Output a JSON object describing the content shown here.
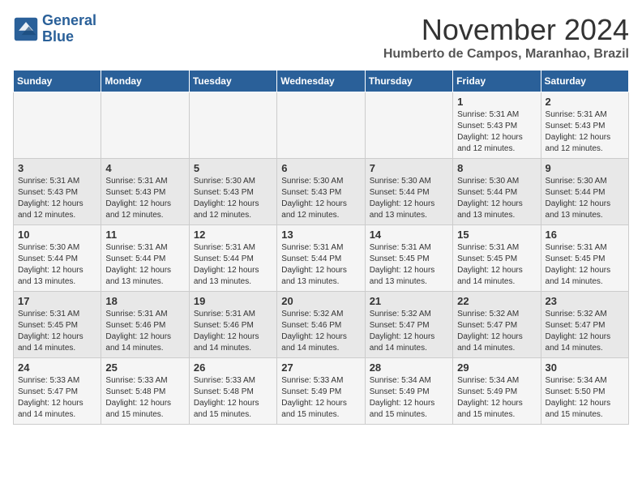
{
  "header": {
    "logo_line1": "General",
    "logo_line2": "Blue",
    "month_year": "November 2024",
    "location": "Humberto de Campos, Maranhao, Brazil"
  },
  "days_of_week": [
    "Sunday",
    "Monday",
    "Tuesday",
    "Wednesday",
    "Thursday",
    "Friday",
    "Saturday"
  ],
  "weeks": [
    [
      {
        "day": "",
        "info": ""
      },
      {
        "day": "",
        "info": ""
      },
      {
        "day": "",
        "info": ""
      },
      {
        "day": "",
        "info": ""
      },
      {
        "day": "",
        "info": ""
      },
      {
        "day": "1",
        "info": "Sunrise: 5:31 AM\nSunset: 5:43 PM\nDaylight: 12 hours\nand 12 minutes."
      },
      {
        "day": "2",
        "info": "Sunrise: 5:31 AM\nSunset: 5:43 PM\nDaylight: 12 hours\nand 12 minutes."
      }
    ],
    [
      {
        "day": "3",
        "info": "Sunrise: 5:31 AM\nSunset: 5:43 PM\nDaylight: 12 hours\nand 12 minutes."
      },
      {
        "day": "4",
        "info": "Sunrise: 5:31 AM\nSunset: 5:43 PM\nDaylight: 12 hours\nand 12 minutes."
      },
      {
        "day": "5",
        "info": "Sunrise: 5:30 AM\nSunset: 5:43 PM\nDaylight: 12 hours\nand 12 minutes."
      },
      {
        "day": "6",
        "info": "Sunrise: 5:30 AM\nSunset: 5:43 PM\nDaylight: 12 hours\nand 12 minutes."
      },
      {
        "day": "7",
        "info": "Sunrise: 5:30 AM\nSunset: 5:44 PM\nDaylight: 12 hours\nand 13 minutes."
      },
      {
        "day": "8",
        "info": "Sunrise: 5:30 AM\nSunset: 5:44 PM\nDaylight: 12 hours\nand 13 minutes."
      },
      {
        "day": "9",
        "info": "Sunrise: 5:30 AM\nSunset: 5:44 PM\nDaylight: 12 hours\nand 13 minutes."
      }
    ],
    [
      {
        "day": "10",
        "info": "Sunrise: 5:30 AM\nSunset: 5:44 PM\nDaylight: 12 hours\nand 13 minutes."
      },
      {
        "day": "11",
        "info": "Sunrise: 5:31 AM\nSunset: 5:44 PM\nDaylight: 12 hours\nand 13 minutes."
      },
      {
        "day": "12",
        "info": "Sunrise: 5:31 AM\nSunset: 5:44 PM\nDaylight: 12 hours\nand 13 minutes."
      },
      {
        "day": "13",
        "info": "Sunrise: 5:31 AM\nSunset: 5:44 PM\nDaylight: 12 hours\nand 13 minutes."
      },
      {
        "day": "14",
        "info": "Sunrise: 5:31 AM\nSunset: 5:45 PM\nDaylight: 12 hours\nand 13 minutes."
      },
      {
        "day": "15",
        "info": "Sunrise: 5:31 AM\nSunset: 5:45 PM\nDaylight: 12 hours\nand 14 minutes."
      },
      {
        "day": "16",
        "info": "Sunrise: 5:31 AM\nSunset: 5:45 PM\nDaylight: 12 hours\nand 14 minutes."
      }
    ],
    [
      {
        "day": "17",
        "info": "Sunrise: 5:31 AM\nSunset: 5:45 PM\nDaylight: 12 hours\nand 14 minutes."
      },
      {
        "day": "18",
        "info": "Sunrise: 5:31 AM\nSunset: 5:46 PM\nDaylight: 12 hours\nand 14 minutes."
      },
      {
        "day": "19",
        "info": "Sunrise: 5:31 AM\nSunset: 5:46 PM\nDaylight: 12 hours\nand 14 minutes."
      },
      {
        "day": "20",
        "info": "Sunrise: 5:32 AM\nSunset: 5:46 PM\nDaylight: 12 hours\nand 14 minutes."
      },
      {
        "day": "21",
        "info": "Sunrise: 5:32 AM\nSunset: 5:47 PM\nDaylight: 12 hours\nand 14 minutes."
      },
      {
        "day": "22",
        "info": "Sunrise: 5:32 AM\nSunset: 5:47 PM\nDaylight: 12 hours\nand 14 minutes."
      },
      {
        "day": "23",
        "info": "Sunrise: 5:32 AM\nSunset: 5:47 PM\nDaylight: 12 hours\nand 14 minutes."
      }
    ],
    [
      {
        "day": "24",
        "info": "Sunrise: 5:33 AM\nSunset: 5:47 PM\nDaylight: 12 hours\nand 14 minutes."
      },
      {
        "day": "25",
        "info": "Sunrise: 5:33 AM\nSunset: 5:48 PM\nDaylight: 12 hours\nand 15 minutes."
      },
      {
        "day": "26",
        "info": "Sunrise: 5:33 AM\nSunset: 5:48 PM\nDaylight: 12 hours\nand 15 minutes."
      },
      {
        "day": "27",
        "info": "Sunrise: 5:33 AM\nSunset: 5:49 PM\nDaylight: 12 hours\nand 15 minutes."
      },
      {
        "day": "28",
        "info": "Sunrise: 5:34 AM\nSunset: 5:49 PM\nDaylight: 12 hours\nand 15 minutes."
      },
      {
        "day": "29",
        "info": "Sunrise: 5:34 AM\nSunset: 5:49 PM\nDaylight: 12 hours\nand 15 minutes."
      },
      {
        "day": "30",
        "info": "Sunrise: 5:34 AM\nSunset: 5:50 PM\nDaylight: 12 hours\nand 15 minutes."
      }
    ]
  ]
}
